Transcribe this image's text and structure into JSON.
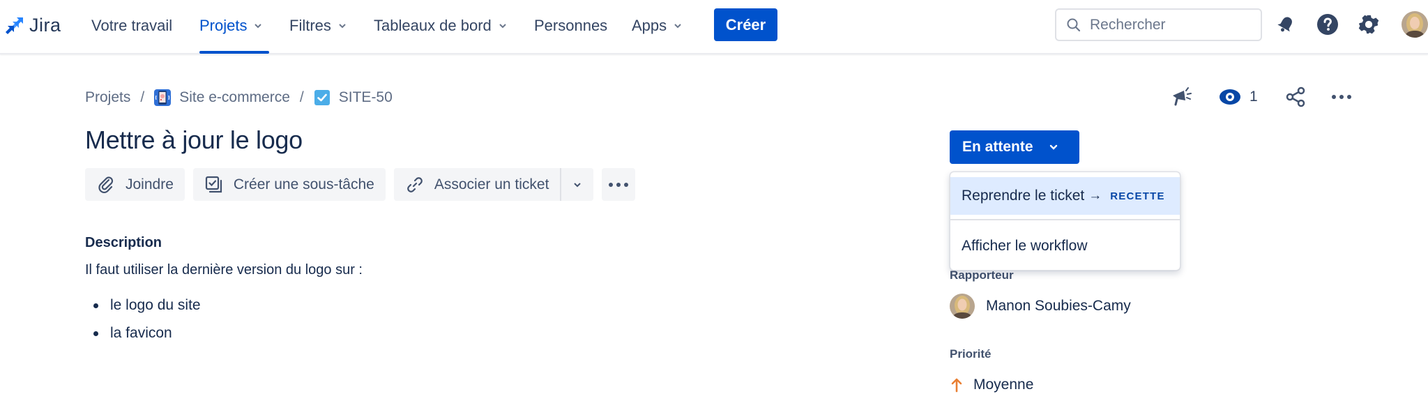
{
  "app": {
    "name": "Jira"
  },
  "nav": {
    "items": [
      {
        "label": "Votre travail",
        "has_dropdown": false,
        "active": false
      },
      {
        "label": "Projets",
        "has_dropdown": true,
        "active": true
      },
      {
        "label": "Filtres",
        "has_dropdown": true,
        "active": false
      },
      {
        "label": "Tableaux de bord",
        "has_dropdown": true,
        "active": false
      },
      {
        "label": "Personnes",
        "has_dropdown": false,
        "active": false
      },
      {
        "label": "Apps",
        "has_dropdown": true,
        "active": false
      }
    ],
    "create_label": "Créer",
    "search_placeholder": "Rechercher",
    "icons": [
      "notifications-icon",
      "help-icon",
      "settings-icon",
      "profile-avatar"
    ]
  },
  "breadcrumb": {
    "items": [
      {
        "label": "Projets",
        "icon": null
      },
      {
        "label": "Site e-commerce",
        "icon": "project-avatar-icon"
      },
      {
        "label": "SITE-50",
        "icon": "task-checkbox-icon"
      }
    ],
    "separator": "/"
  },
  "issue": {
    "title": "Mettre à jour le logo",
    "actions": {
      "attach": "Joindre",
      "subtask": "Créer une sous-tâche",
      "link": "Associer un ticket"
    },
    "description": {
      "heading": "Description",
      "text": "Il faut utiliser la dernière version du logo sur :",
      "list": [
        "le logo du site",
        "la favicon"
      ]
    }
  },
  "header_actions": {
    "watch_count": "1"
  },
  "status": {
    "current": "En attente",
    "menu": {
      "transition_label": "Reprendre le ticket",
      "transition_arrow": "→",
      "transition_target": "RECETTE",
      "workflow_label": "Afficher le workflow"
    }
  },
  "fields": {
    "reporter_label": "Rapporteur",
    "reporter_name": "Manon Soubies-Camy",
    "priority_label": "Priorité",
    "priority_value": "Moyenne"
  },
  "colors": {
    "brand": "#0052cc",
    "text": "#172b4d",
    "subtle_text": "#5e6c84",
    "button_bg": "#f4f5f7",
    "dropdown_highlight": "#deebff",
    "priority_medium": "#e97f33"
  }
}
